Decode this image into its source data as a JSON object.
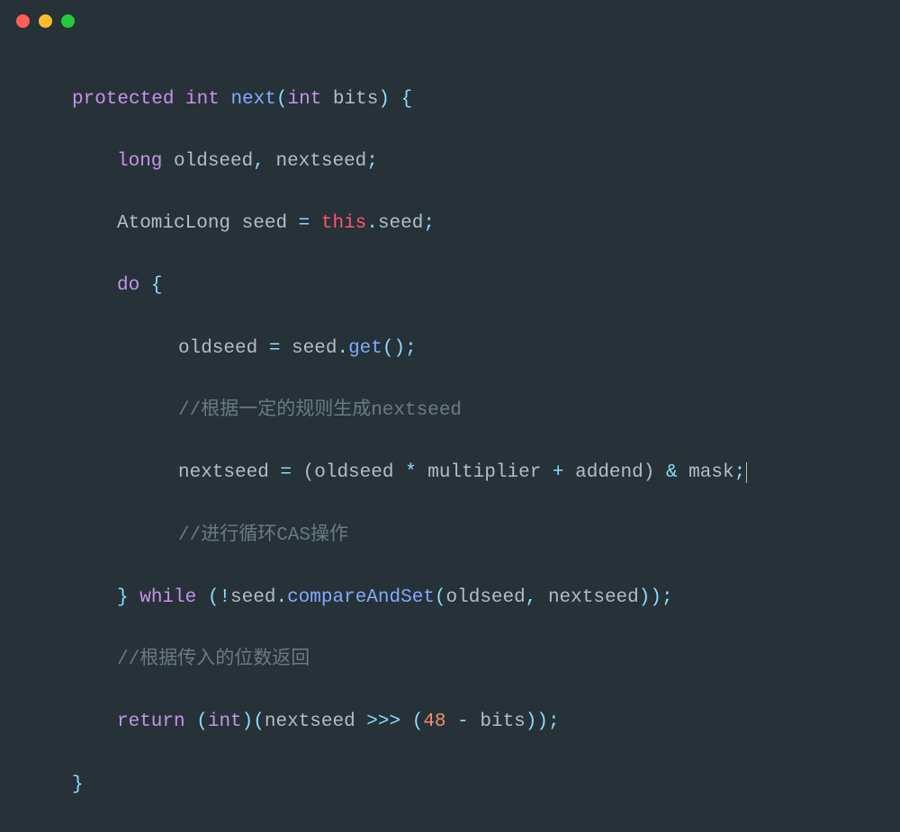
{
  "titlebar": {
    "dots": [
      "red",
      "yellow",
      "green"
    ]
  },
  "code": {
    "l1": {
      "kw1": "protected",
      "type1": "int",
      "fn": "next",
      "p1": "(",
      "type2": "int",
      "arg": " bits",
      "p2": ")",
      "p3": " {"
    },
    "l2": {
      "type": "long",
      "v1": " oldseed",
      "c": ",",
      "v2": " nextseed",
      "sc": ";"
    },
    "l3": {
      "cls": "AtomicLong",
      "var": " seed ",
      "eq": "=",
      "this": " this",
      "dot": ".",
      "prop": "seed",
      "sc": ";"
    },
    "l4": {
      "kw": "do",
      "sp": " ",
      "br": "{"
    },
    "l5": {
      "v": "oldseed ",
      "eq": "=",
      "v2": " seed",
      "dot": ".",
      "m": "get",
      "p": "();"
    },
    "l6": {
      "c": "//根据一定的规则生成nextseed"
    },
    "l7": {
      "v": "nextseed ",
      "eq": "=",
      "v2": " (oldseed ",
      "op1": "*",
      "v3": " multiplier ",
      "op2": "+",
      "v4": " addend) ",
      "op3": "&",
      "v5": " mask",
      "sc": ";"
    },
    "l8": {
      "c": "//进行循环CAS操作"
    },
    "l9": {
      "br": "}",
      "sp": " ",
      "kw": "while",
      "p1": " (!",
      "v1": "seed",
      "dot": ".",
      "m": "compareAndSet",
      "p2": "(",
      "a1": "oldseed",
      "c": ",",
      "a2": " nextseed",
      "p3": "));"
    },
    "l10": {
      "c": "//根据传入的位数返回"
    },
    "l11": {
      "kw": "return",
      "p1": " (",
      "type": "int",
      "p2": ")(",
      "v": "nextseed ",
      "op": ">>>",
      "p3": " (",
      "n": "48",
      "op2": " -",
      "v2": " bits",
      "p4": "));"
    },
    "l12": {
      "br": "}"
    }
  }
}
